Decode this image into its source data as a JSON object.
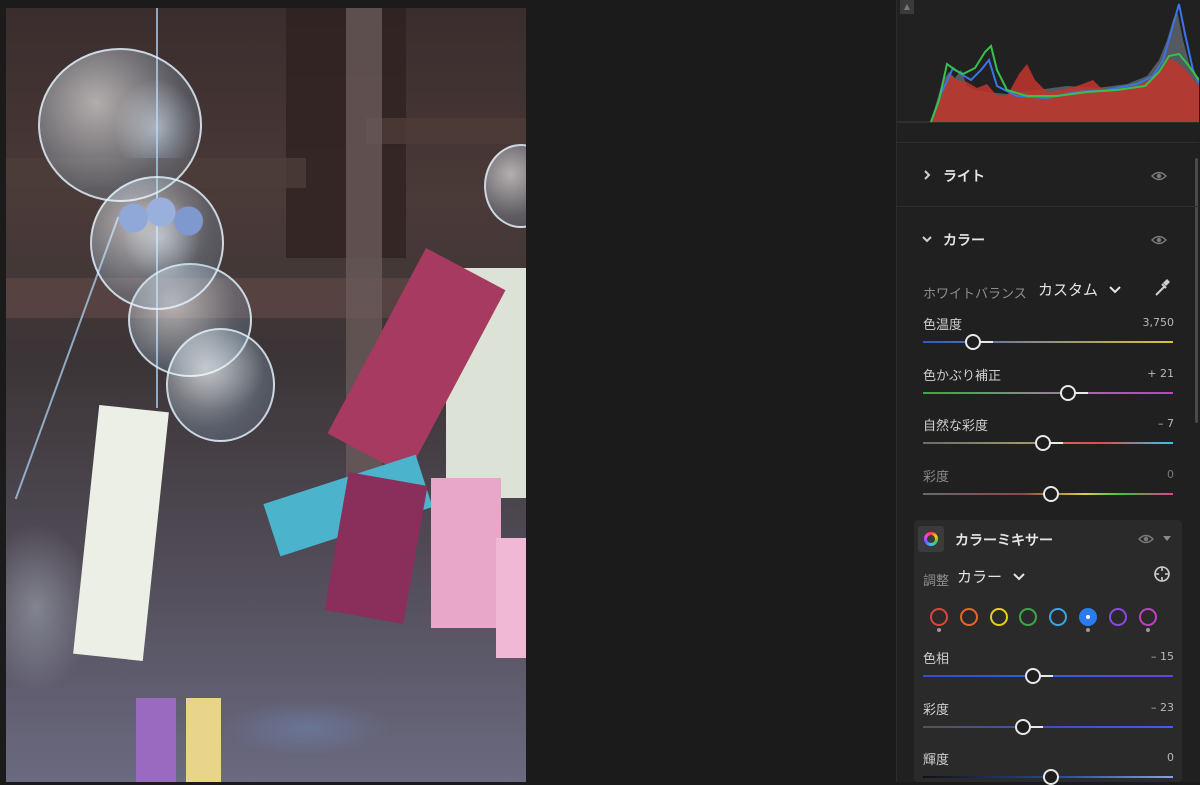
{
  "panel": {
    "sections": {
      "light": {
        "title": "ライト",
        "expanded": false
      },
      "color": {
        "title": "カラー",
        "expanded": true
      }
    },
    "white_balance": {
      "label": "ホワイトバランス",
      "value": "カスタム"
    },
    "color_sliders": [
      {
        "label": "色温度",
        "value": "3,750",
        "dim": false,
        "position": 0.2
      },
      {
        "label": "色かぶり補正",
        "value": "+ 21",
        "dim": false,
        "position": 0.58
      },
      {
        "label": "自然な彩度",
        "value": "– 7",
        "dim": false,
        "position": 0.48
      },
      {
        "label": "彩度",
        "value": "0",
        "dim": true,
        "position": 0.51
      }
    ],
    "color_mixer": {
      "title": "カラーミキサー",
      "adjust_label": "調整",
      "adjust_value": "カラー",
      "swatches": [
        {
          "name": "red",
          "color": "#e0433a",
          "dot": true
        },
        {
          "name": "orange",
          "color": "#e8652f",
          "dot": false
        },
        {
          "name": "yellow",
          "color": "#e6cf1e",
          "dot": false
        },
        {
          "name": "green",
          "color": "#3aa84a",
          "dot": false
        },
        {
          "name": "aqua",
          "color": "#3aa6e0",
          "dot": false
        },
        {
          "name": "blue",
          "color": "#2a7cf0",
          "dot": true,
          "selected": true
        },
        {
          "name": "purple",
          "color": "#8a4ae0",
          "dot": false
        },
        {
          "name": "magenta",
          "color": "#c040c0",
          "dot": true
        }
      ],
      "sliders": [
        {
          "label": "色相",
          "value": "– 15",
          "position": 0.44
        },
        {
          "label": "彩度",
          "value": "– 23",
          "position": 0.4
        },
        {
          "label": "輝度",
          "value": "0",
          "position": 0.51
        }
      ]
    }
  }
}
